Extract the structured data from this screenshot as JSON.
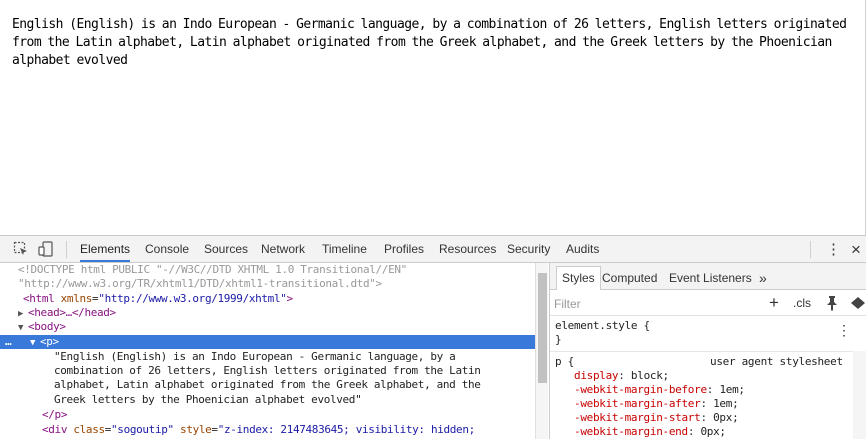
{
  "page": {
    "paragraph": "English (English) is an Indo European - Germanic language, by a combination of 26 letters, English letters originated from the Latin alphabet, Latin alphabet originated from the Greek alphabet, and the Greek letters by the Phoenician alphabet evolved"
  },
  "devtools": {
    "tabs": [
      {
        "label": "Elements",
        "active": true
      },
      {
        "label": "Console"
      },
      {
        "label": "Sources"
      },
      {
        "label": "Network"
      },
      {
        "label": "Timeline"
      },
      {
        "label": "Profiles"
      },
      {
        "label": "Resources"
      },
      {
        "label": "Security"
      },
      {
        "label": "Audits"
      }
    ],
    "icons": {
      "inspect": "inspect-icon",
      "device": "device-mode-icon",
      "menu": "more-vertical-icon",
      "close": "close-icon"
    },
    "close_label": "×",
    "menu_label": "⋮",
    "accent_color": "#3879d9"
  },
  "dom_tree": {
    "doctype_1": "<!DOCTYPE html PUBLIC \"-//W3C//DTD XHTML 1.0 Transitional//EN\"",
    "doctype_2": "\"http://www.w3.org/TR/xhtml1/DTD/xhtml1-transitional.dtd\">",
    "html_open": "<html",
    "html_attr": "xmlns",
    "html_val": "\"http://www.w3.org/1999/xhtml\"",
    "html_close": ">",
    "head": "<head>…</head>",
    "body": "<body>",
    "selected_marker": "…",
    "p_open": "<p>",
    "p_text_1": "\"English (English) is an Indo European - Germanic language, by a",
    "p_text_2": "combination of 26 letters, English letters originated from the Latin",
    "p_text_3": "alphabet, Latin alphabet originated from the Greek alphabet, and the",
    "p_text_4": "Greek letters by the Phoenician alphabet evolved\"",
    "p_close": "</p>",
    "div_open": "<div",
    "div_attr1": "class",
    "div_val1": "\"sogoutip\"",
    "div_attr2": "style",
    "div_val2": "\"z-index: 2147483645; visibility: hidden;"
  },
  "styles": {
    "tabs": [
      {
        "label": "Styles",
        "active": true
      },
      {
        "label": "Computed"
      },
      {
        "label": "Event Listeners"
      }
    ],
    "more_tabs": "»",
    "filter_placeholder": "Filter",
    "cls_label": ".cls",
    "plus_label": "+",
    "element_style_selector": "element.style {",
    "element_style_close": "}",
    "rule_selector": "p {",
    "rule_source": "user agent stylesheet",
    "rule_props": [
      {
        "name": "display",
        "value": "block;"
      },
      {
        "name": "-webkit-margin-before",
        "value": "1em;"
      },
      {
        "name": "-webkit-margin-after",
        "value": "1em;"
      },
      {
        "name": "-webkit-margin-start",
        "value": "0px;"
      },
      {
        "name": "-webkit-margin-end",
        "value": "0px;"
      }
    ]
  }
}
